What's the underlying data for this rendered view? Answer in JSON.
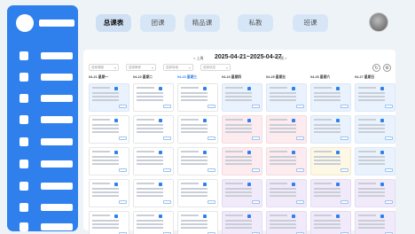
{
  "sidebar": {
    "item_count": 9
  },
  "tabs": [
    {
      "label": "总课表",
      "active": true
    },
    {
      "label": "团课",
      "active": false
    },
    {
      "label": "精品课",
      "active": false
    },
    {
      "label": "私教",
      "active": false
    },
    {
      "label": "班课",
      "active": false
    }
  ],
  "schedule": {
    "range": "2025-04-21~2025-04-27",
    "prev_label": "< 上周",
    "next_label": "下周 >",
    "filters": [
      {
        "placeholder": "选择课程"
      },
      {
        "placeholder": "选择教练"
      },
      {
        "placeholder": "选择场地"
      },
      {
        "placeholder": "选择状态"
      }
    ],
    "action_icons": [
      "refresh-icon",
      "settings-icon"
    ],
    "days": [
      {
        "label": "04-21 星期一",
        "today": false
      },
      {
        "label": "04-22 星期二",
        "today": false
      },
      {
        "label": "04-23 星期三",
        "today": true
      },
      {
        "label": "04-24 星期四",
        "today": false
      },
      {
        "label": "04-25 星期五",
        "today": false
      },
      {
        "label": "04-26 星期六",
        "today": false
      },
      {
        "label": "04-27 星期日",
        "today": false
      }
    ]
  }
}
